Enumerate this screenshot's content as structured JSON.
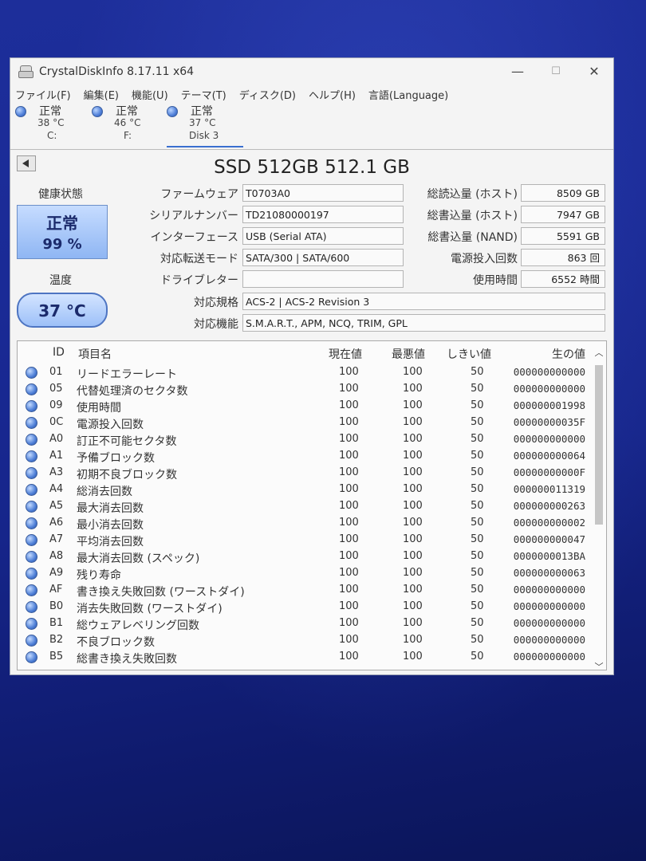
{
  "window": {
    "title": "CrystalDiskInfo 8.17.11 x64",
    "minimize": "—",
    "maximize": "☐",
    "close": "✕"
  },
  "menu": [
    "ファイル(F)",
    "編集(E)",
    "機能(U)",
    "テーマ(T)",
    "ディスク(D)",
    "ヘルプ(H)",
    "言語(Language)"
  ],
  "disks": [
    {
      "status": "正常",
      "temp": "38 °C",
      "label": "C:"
    },
    {
      "status": "正常",
      "temp": "46 °C",
      "label": "F:"
    },
    {
      "status": "正常",
      "temp": "37 °C",
      "label": "Disk 3"
    }
  ],
  "model": "SSD 512GB 512.1 GB",
  "health": {
    "label": "健康状態",
    "status": "正常",
    "percent": "99 %"
  },
  "temperature": {
    "label": "温度",
    "value": "37 °C"
  },
  "info": {
    "firmware_label": "ファームウェア",
    "firmware": "T0703A0",
    "serial_label": "シリアルナンバー",
    "serial": "TD21080000197",
    "interface_label": "インターフェース",
    "interface": "USB (Serial ATA)",
    "transfer_label": "対応転送モード",
    "transfer": "SATA/300 | SATA/600",
    "drive_letter_label": "ドライブレター",
    "drive_letter": "",
    "standard_label": "対応規格",
    "standard": "ACS-2 | ACS-2 Revision 3",
    "features_label": "対応機能",
    "features": "S.M.A.R.T., APM, NCQ, TRIM, GPL"
  },
  "stats": {
    "host_reads_label": "総読込量 (ホスト)",
    "host_reads": "8509 GB",
    "host_writes_label": "総書込量 (ホスト)",
    "host_writes": "7947 GB",
    "nand_writes_label": "総書込量 (NAND)",
    "nand_writes": "5591 GB",
    "power_on_count_label": "電源投入回数",
    "power_on_count": "863 回",
    "power_on_hours_label": "使用時間",
    "power_on_hours": "6552 時間"
  },
  "table": {
    "headers": {
      "id": "ID",
      "name": "項目名",
      "current": "現在値",
      "worst": "最悪値",
      "threshold": "しきい値",
      "raw": "生の値"
    },
    "rows": [
      {
        "id": "01",
        "name": "リードエラーレート",
        "current": "100",
        "worst": "100",
        "threshold": "50",
        "raw": "000000000000"
      },
      {
        "id": "05",
        "name": "代替処理済のセクタ数",
        "current": "100",
        "worst": "100",
        "threshold": "50",
        "raw": "000000000000"
      },
      {
        "id": "09",
        "name": "使用時間",
        "current": "100",
        "worst": "100",
        "threshold": "50",
        "raw": "000000001998"
      },
      {
        "id": "0C",
        "name": "電源投入回数",
        "current": "100",
        "worst": "100",
        "threshold": "50",
        "raw": "00000000035F"
      },
      {
        "id": "A0",
        "name": "訂正不可能セクタ数",
        "current": "100",
        "worst": "100",
        "threshold": "50",
        "raw": "000000000000"
      },
      {
        "id": "A1",
        "name": "予備ブロック数",
        "current": "100",
        "worst": "100",
        "threshold": "50",
        "raw": "000000000064"
      },
      {
        "id": "A3",
        "name": "初期不良ブロック数",
        "current": "100",
        "worst": "100",
        "threshold": "50",
        "raw": "00000000000F"
      },
      {
        "id": "A4",
        "name": "総消去回数",
        "current": "100",
        "worst": "100",
        "threshold": "50",
        "raw": "000000011319"
      },
      {
        "id": "A5",
        "name": "最大消去回数",
        "current": "100",
        "worst": "100",
        "threshold": "50",
        "raw": "000000000263"
      },
      {
        "id": "A6",
        "name": "最小消去回数",
        "current": "100",
        "worst": "100",
        "threshold": "50",
        "raw": "000000000002"
      },
      {
        "id": "A7",
        "name": "平均消去回数",
        "current": "100",
        "worst": "100",
        "threshold": "50",
        "raw": "000000000047"
      },
      {
        "id": "A8",
        "name": "最大消去回数 (スペック)",
        "current": "100",
        "worst": "100",
        "threshold": "50",
        "raw": "0000000013BA"
      },
      {
        "id": "A9",
        "name": "残り寿命",
        "current": "100",
        "worst": "100",
        "threshold": "50",
        "raw": "000000000063"
      },
      {
        "id": "AF",
        "name": "書き換え失敗回数 (ワーストダイ)",
        "current": "100",
        "worst": "100",
        "threshold": "50",
        "raw": "000000000000"
      },
      {
        "id": "B0",
        "name": "消去失敗回数 (ワーストダイ)",
        "current": "100",
        "worst": "100",
        "threshold": "50",
        "raw": "000000000000"
      },
      {
        "id": "B1",
        "name": "総ウェアレベリング回数",
        "current": "100",
        "worst": "100",
        "threshold": "50",
        "raw": "000000000000"
      },
      {
        "id": "B2",
        "name": "不良ブロック数",
        "current": "100",
        "worst": "100",
        "threshold": "50",
        "raw": "000000000000"
      },
      {
        "id": "B5",
        "name": "総書き換え失敗回数",
        "current": "100",
        "worst": "100",
        "threshold": "50",
        "raw": "000000000000"
      }
    ]
  }
}
